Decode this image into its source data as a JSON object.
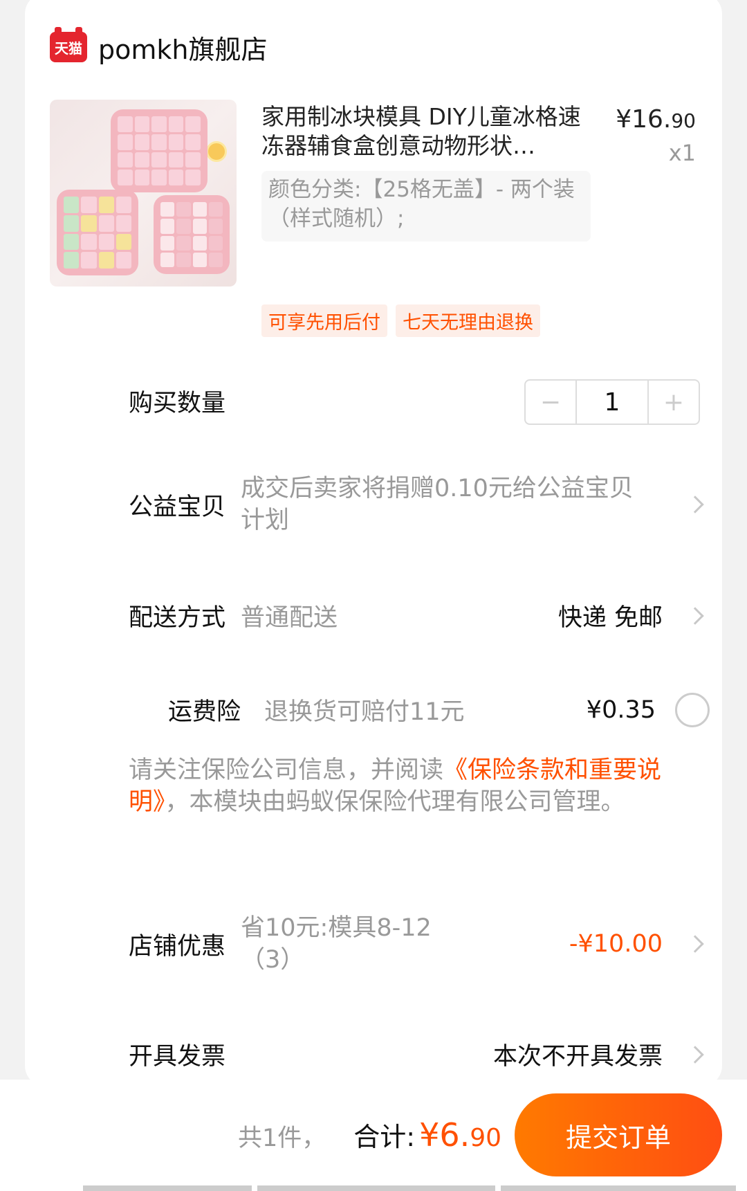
{
  "shop": {
    "logo_text": "天猫",
    "name": "pomkh旗舰店"
  },
  "product": {
    "title": "家用制冰块模具 DIY儿童冰格速冻器辅食盒创意动物形状…",
    "price_int": "¥16.",
    "price_dec": "90",
    "quantity_tag": "x1",
    "sku": "颜色分类:【25格无盖】- 两个装（样式随机）;",
    "tags": [
      "可享先用后付",
      "七天无理由退换"
    ]
  },
  "quantity": {
    "label": "购买数量",
    "value": "1",
    "minus": "−",
    "plus": "+"
  },
  "charity": {
    "label": "公益宝贝",
    "text": "成交后卖家将捐赠0.10元给公益宝贝计划"
  },
  "delivery": {
    "label": "配送方式",
    "value": "普通配送",
    "right": "快递 免邮"
  },
  "insurance": {
    "label": "运费险",
    "value": "退换货可赔付11元",
    "price": "¥0.35"
  },
  "notice": {
    "prefix": "请关注保险公司信息，并阅读",
    "link": "《保险条款和重要说明》",
    "suffix": "，本模块由蚂蚁保保险代理有限公司管理。"
  },
  "discount": {
    "label": "店铺优惠",
    "value": "省10元:模具8-12（3）",
    "amount": "-¥10.00"
  },
  "invoice": {
    "label": "开具发票",
    "value": "本次不开具发票"
  },
  "footer": {
    "count": "共1件，",
    "total_label": "合计:",
    "total_int": "¥6.",
    "total_dec": "90",
    "submit": "提交订单"
  },
  "colors": {
    "accent": "#ff5000",
    "muted": "#999999"
  }
}
